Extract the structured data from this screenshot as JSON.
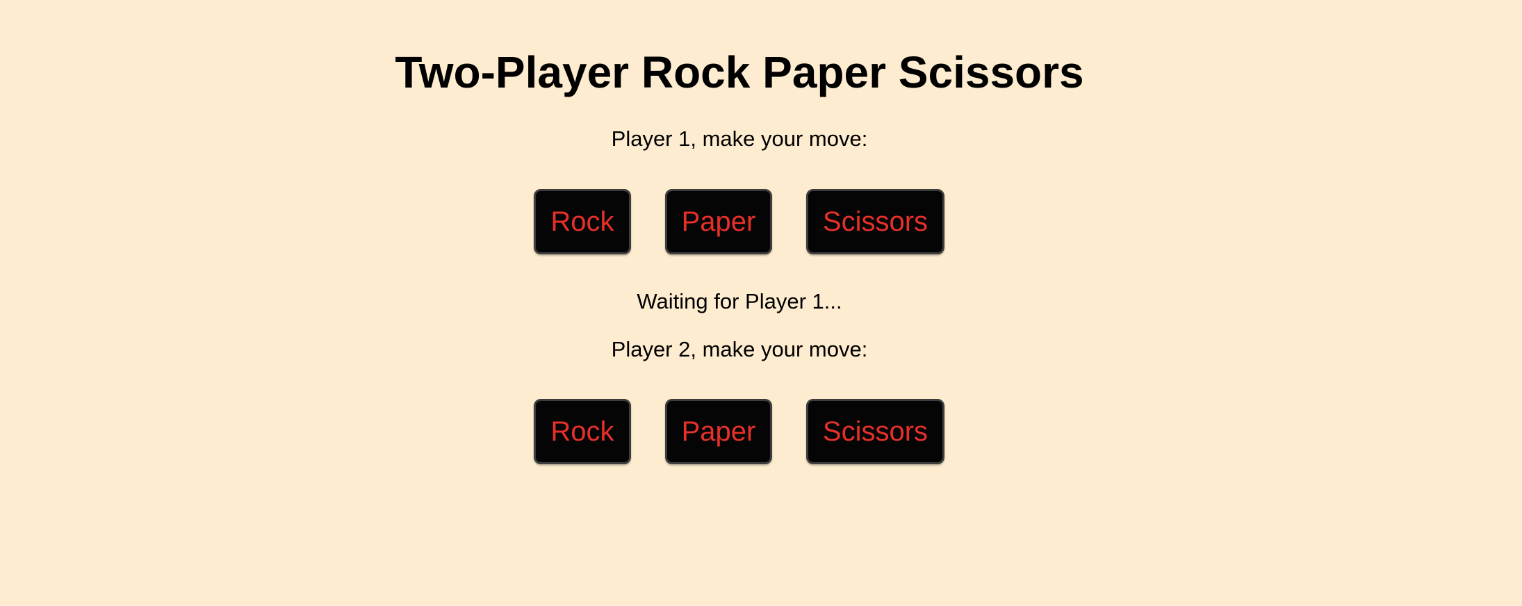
{
  "title": "Two-Player Rock Paper Scissors",
  "player1": {
    "prompt": "Player 1, make your move:",
    "buttons": [
      "Rock",
      "Paper",
      "Scissors"
    ]
  },
  "status": "Waiting for Player 1...",
  "player2": {
    "prompt": "Player 2, make your move:",
    "buttons": [
      "Rock",
      "Paper",
      "Scissors"
    ]
  },
  "colors": {
    "background": "#fdeccf",
    "button_background": "#050505",
    "button_text": "#e8302a"
  }
}
